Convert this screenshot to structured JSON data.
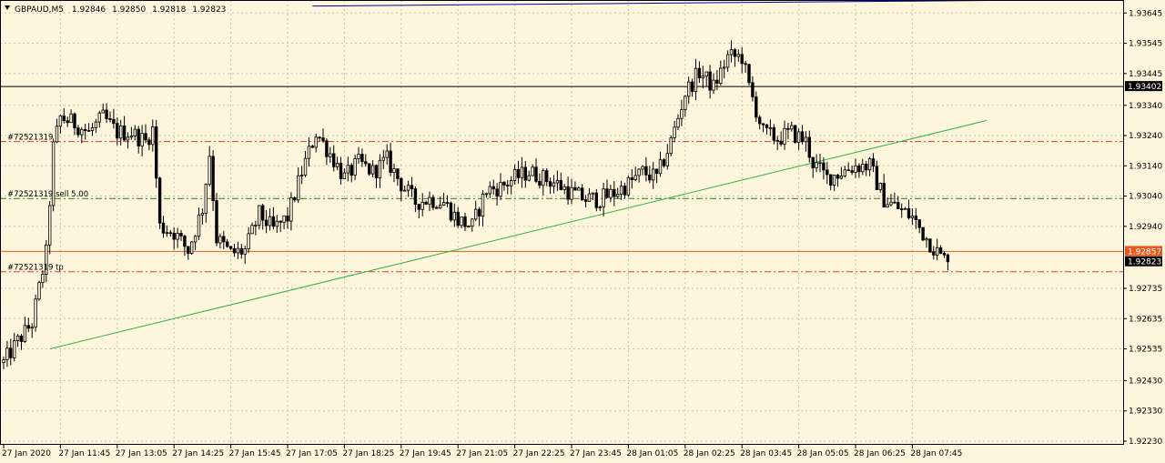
{
  "header": {
    "symbol": "GBPAUD,M5",
    "open": "1.92846",
    "high": "1.92850",
    "low": "1.92818",
    "close": "1.92823"
  },
  "orders": [
    {
      "label": "#72521319",
      "price": 1.9322,
      "color": "#e03a1e"
    },
    {
      "label": "#72521319 sell 5.00",
      "price": 1.93032,
      "color": "#1f7a1f"
    },
    {
      "label": "#72521319 tp",
      "price": 1.9279,
      "color": "#e03a1e"
    }
  ],
  "price_lines": [
    {
      "price": 1.93402,
      "label": "1.93402",
      "color": "#000000",
      "badge_bg": "#000000",
      "badge_fg": "#ffffff"
    },
    {
      "price": 1.92857,
      "label": "1.92857",
      "color": "#e8581c",
      "badge_bg": "#e8581c",
      "badge_fg": "#ffffff"
    },
    {
      "price": 1.92823,
      "label": "1.92823",
      "color": null,
      "badge_bg": "#000000",
      "badge_fg": "#ffffff"
    }
  ],
  "chart_data": {
    "type": "candlestick",
    "symbol": "GBPAUD",
    "timeframe": "M5",
    "ylim": [
      1.9223,
      1.937
    ],
    "y_ticks": [
      "1.93645",
      "1.93545",
      "1.93445",
      "1.93340",
      "1.93240",
      "1.93140",
      "1.93040",
      "1.92940",
      "1.92735",
      "1.92635",
      "1.92535",
      "1.92430",
      "1.92330",
      "1.92230"
    ],
    "x_ticks": [
      "27 Jan 2020",
      "27 Jan 11:45",
      "27 Jan 13:05",
      "27 Jan 14:25",
      "27 Jan 15:45",
      "27 Jan 17:05",
      "27 Jan 18:25",
      "27 Jan 19:45",
      "27 Jan 21:05",
      "27 Jan 22:25",
      "27 Jan 23:45",
      "28 Jan 01:05",
      "28 Jan 02:25",
      "28 Jan 03:45",
      "28 Jan 05:05",
      "28 Jan 06:25",
      "28 Jan 07:45"
    ],
    "grid": true,
    "bar_count": 267,
    "bars_per_tick": 16,
    "close_path": [
      [
        0,
        1.9249
      ],
      [
        4,
        1.9256
      ],
      [
        8,
        1.9262
      ],
      [
        12,
        1.9285
      ],
      [
        14,
        1.932
      ],
      [
        16,
        1.933
      ],
      [
        20,
        1.9328
      ],
      [
        24,
        1.9325
      ],
      [
        28,
        1.933
      ],
      [
        32,
        1.9325
      ],
      [
        36,
        1.9325
      ],
      [
        40,
        1.9322
      ],
      [
        42,
        1.9326
      ],
      [
        44,
        1.9294
      ],
      [
        48,
        1.9292
      ],
      [
        52,
        1.9286
      ],
      [
        56,
        1.93
      ],
      [
        58,
        1.9318
      ],
      [
        60,
        1.929
      ],
      [
        64,
        1.9285
      ],
      [
        68,
        1.9286
      ],
      [
        72,
        1.9298
      ],
      [
        76,
        1.9293
      ],
      [
        80,
        1.9297
      ],
      [
        84,
        1.9312
      ],
      [
        88,
        1.9325
      ],
      [
        92,
        1.9318
      ],
      [
        96,
        1.931
      ],
      [
        100,
        1.9315
      ],
      [
        104,
        1.9312
      ],
      [
        108,
        1.9316
      ],
      [
        112,
        1.9308
      ],
      [
        116,
        1.9302
      ],
      [
        120,
        1.9303
      ],
      [
        124,
        1.9302
      ],
      [
        128,
        1.9296
      ],
      [
        132,
        1.9294
      ],
      [
        136,
        1.9306
      ],
      [
        140,
        1.9307
      ],
      [
        144,
        1.931
      ],
      [
        148,
        1.9312
      ],
      [
        152,
        1.931
      ],
      [
        156,
        1.9308
      ],
      [
        160,
        1.9305
      ],
      [
        164,
        1.9303
      ],
      [
        168,
        1.9303
      ],
      [
        172,
        1.9305
      ],
      [
        176,
        1.9308
      ],
      [
        180,
        1.9312
      ],
      [
        184,
        1.931
      ],
      [
        188,
        1.9322
      ],
      [
        192,
        1.9338
      ],
      [
        196,
        1.9345
      ],
      [
        200,
        1.934
      ],
      [
        204,
        1.935
      ],
      [
        208,
        1.935
      ],
      [
        210,
        1.934
      ],
      [
        214,
        1.9325
      ],
      [
        218,
        1.9323
      ],
      [
        222,
        1.9325
      ],
      [
        226,
        1.9322
      ],
      [
        228,
        1.9315
      ],
      [
        232,
        1.931
      ],
      [
        236,
        1.9312
      ],
      [
        240,
        1.9314
      ],
      [
        244,
        1.9314
      ],
      [
        248,
        1.9303
      ],
      [
        252,
        1.93
      ],
      [
        256,
        1.9297
      ],
      [
        260,
        1.929
      ],
      [
        264,
        1.9284
      ],
      [
        266,
        1.92823
      ]
    ],
    "trendline": {
      "x1": 13,
      "y1": 1.92535,
      "x2": 277,
      "y2": 1.9329,
      "color": "#2db34a"
    },
    "top_line": {
      "x1": 87,
      "y1": 1.93668,
      "x2": 314,
      "y2": 1.9369,
      "color": "#0000b0"
    }
  }
}
